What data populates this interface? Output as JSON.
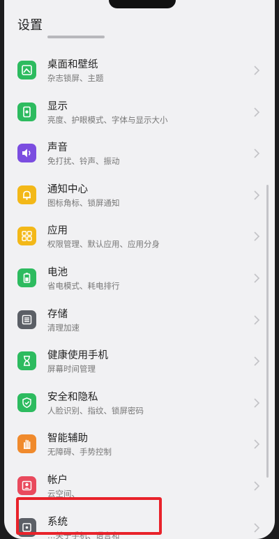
{
  "header": {
    "title": "设置"
  },
  "items": [
    {
      "title": "桌面和壁纸",
      "subtitle": "杂志锁屏、主题",
      "icon": "wallpaper-icon",
      "color": "#2dbb5f"
    },
    {
      "title": "显示",
      "subtitle": "亮度、护眼模式、字体与显示大小",
      "icon": "display-icon",
      "color": "#2dbb5f"
    },
    {
      "title": "声音",
      "subtitle": "免打扰、铃声、振动",
      "icon": "speaker-icon",
      "color": "#7b4de0"
    },
    {
      "title": "通知中心",
      "subtitle": "图标角标、锁屏通知",
      "icon": "bell-icon",
      "color": "#f3b818"
    },
    {
      "title": "应用",
      "subtitle": "权限管理、默认应用、应用分身",
      "icon": "apps-grid-icon",
      "color": "#f3b818"
    },
    {
      "title": "电池",
      "subtitle": "省电模式、耗电排行",
      "icon": "battery-icon",
      "color": "#2dbb5f"
    },
    {
      "title": "存储",
      "subtitle": "清理加速",
      "icon": "storage-icon",
      "color": "#5b5f66"
    },
    {
      "title": "健康使用手机",
      "subtitle": "屏幕时间管理",
      "icon": "hourglass-icon",
      "color": "#2dbb5f"
    },
    {
      "title": "安全和隐私",
      "subtitle": "人脸识别、指纹、锁屏密码",
      "icon": "shield-icon",
      "color": "#2dbb5f"
    },
    {
      "title": "智能辅助",
      "subtitle": "无障碍、手势控制",
      "icon": "hand-icon",
      "color": "#f08a2c"
    },
    {
      "title": "帐户",
      "subtitle": "云空间、",
      "icon": "account-icon",
      "color": "#e94a5d"
    },
    {
      "title": "系统",
      "subtitle": "…关于手机、语言和",
      "icon": "system-icon",
      "color": "#5b5f66"
    }
  ]
}
